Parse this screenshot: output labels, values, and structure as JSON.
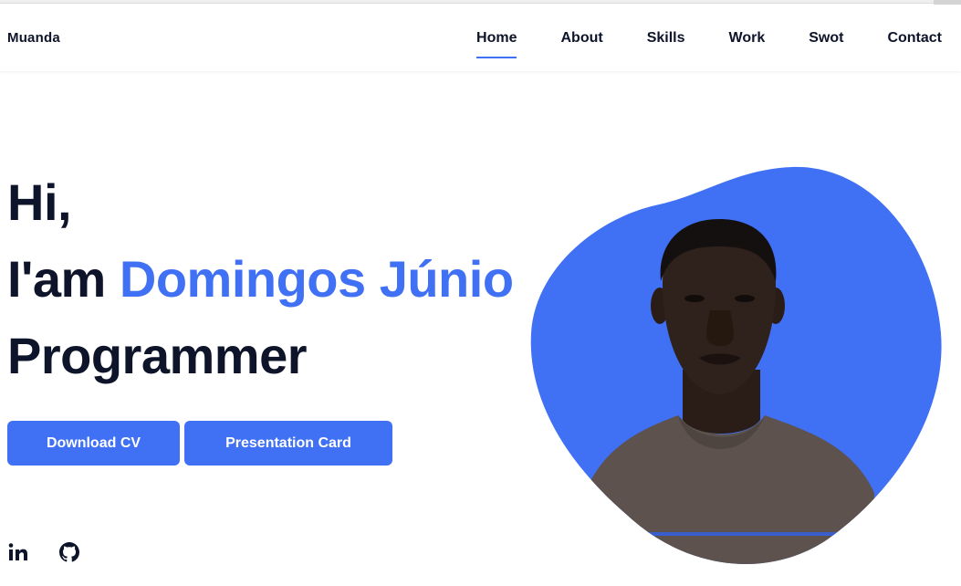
{
  "brand": {
    "logo": "Muanda"
  },
  "nav": {
    "items": [
      {
        "label": "Home",
        "active": true
      },
      {
        "label": "About"
      },
      {
        "label": "Skills"
      },
      {
        "label": "Work"
      },
      {
        "label": "Swot"
      },
      {
        "label": "Contact"
      }
    ]
  },
  "hero": {
    "greeting": "Hi,",
    "intro": "I'am",
    "name": "Domingos Júnio",
    "role": "Programmer",
    "buttons": {
      "download_cv": "Download CV",
      "presentation_card": "Presentation Card"
    },
    "socials": [
      {
        "icon": "linkedin-icon"
      },
      {
        "icon": "github-icon"
      }
    ]
  },
  "colors": {
    "accent": "#4070f4",
    "text": "#0e1429",
    "background": "#ffffff",
    "shirt": "#5d524d",
    "skin": "#2f211b"
  }
}
